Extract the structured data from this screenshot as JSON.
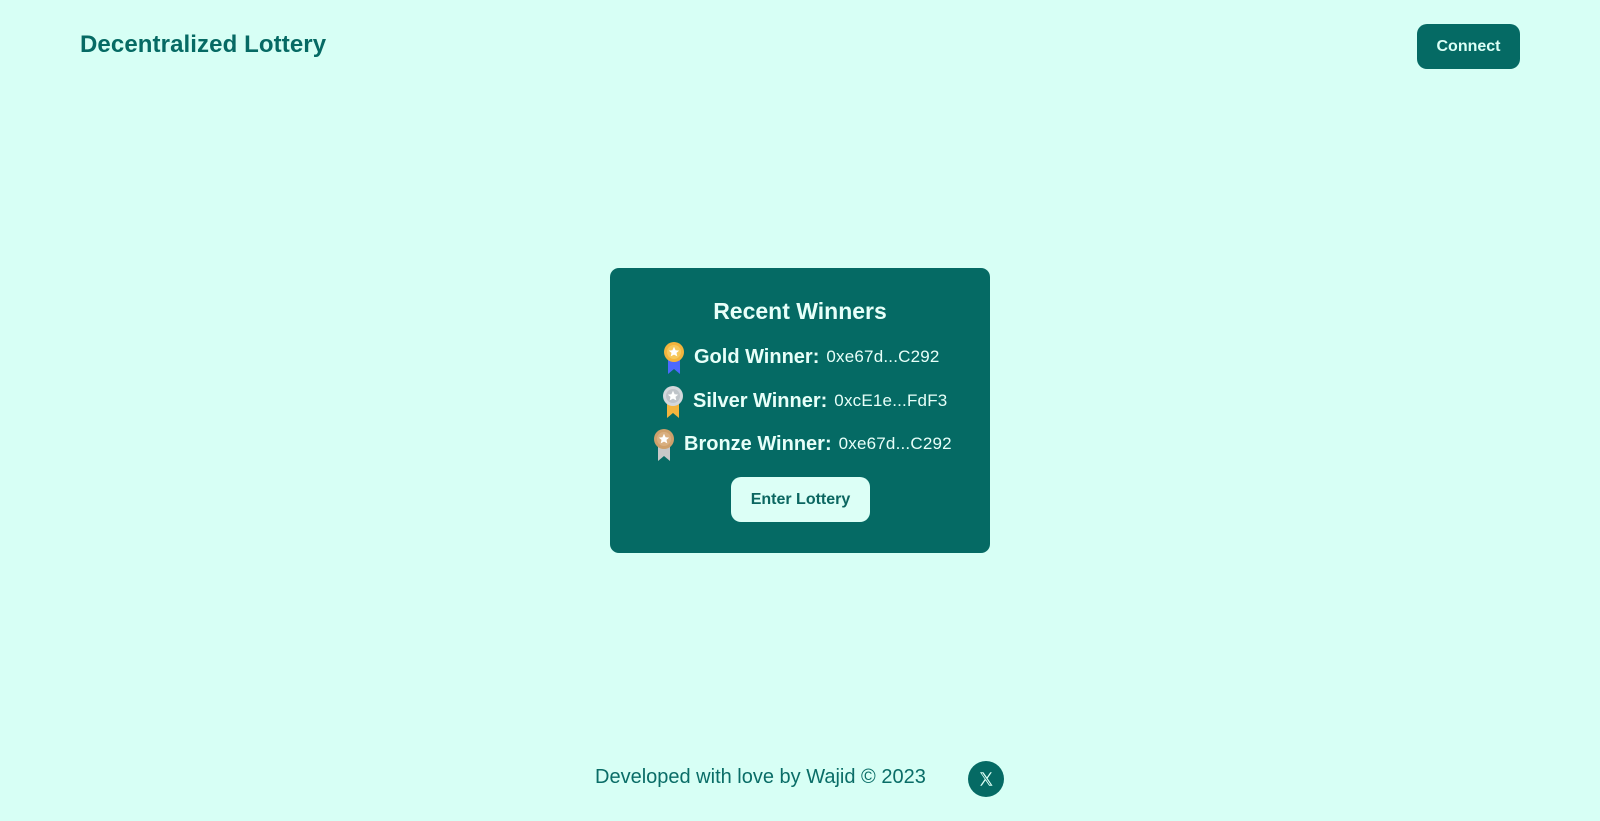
{
  "header": {
    "title": "Decentralized Lottery",
    "connect_label": "Connect"
  },
  "winners_card": {
    "title": "Recent Winners",
    "winners": [
      {
        "label": "Gold Winner:",
        "address": "0xe67d...C292",
        "icon": "gold-medal-icon"
      },
      {
        "label": "Silver Winner:",
        "address": "0xcE1e...FdF3",
        "icon": "silver-medal-icon"
      },
      {
        "label": "Bronze Winner:",
        "address": "0xe67d...C292",
        "icon": "bronze-medal-icon"
      }
    ],
    "enter_label": "Enter Lottery"
  },
  "footer": {
    "text": "Developed with love by Wajid © 2023",
    "social_icon": "x-twitter-icon"
  },
  "colors": {
    "background": "#d7fff5",
    "primary": "#056a64",
    "button_light": "#dcfff6",
    "gold": "#f3b43d",
    "silver": "#d4d8dc",
    "bronze": "#cfa06b",
    "ribbon_blue": "#4c69ff"
  }
}
